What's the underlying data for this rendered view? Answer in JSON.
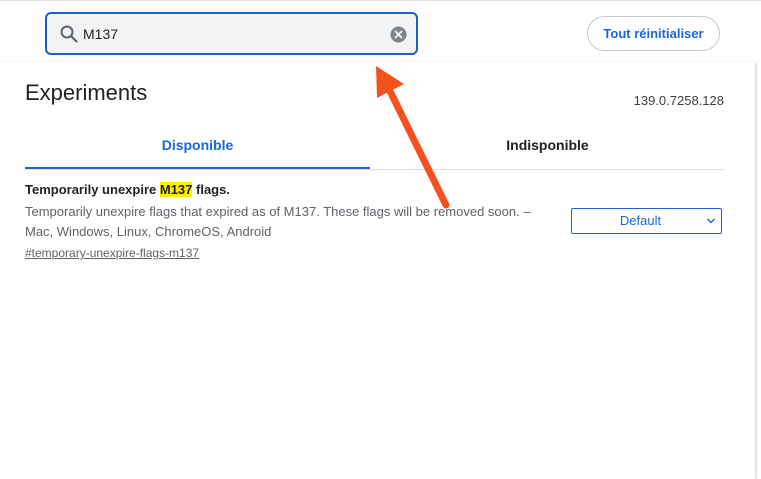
{
  "search": {
    "value": "M137",
    "icon": "search-icon",
    "clear_icon": "clear-icon"
  },
  "header": {
    "reset_label": "Tout réinitialiser"
  },
  "main": {
    "title": "Experiments",
    "version": "139.0.7258.128",
    "tabs": [
      {
        "label": "Disponible",
        "active": true
      },
      {
        "label": "Indisponible",
        "active": false
      }
    ]
  },
  "flag": {
    "name_prefix": "Temporarily unexpire ",
    "name_highlight": "M137",
    "name_suffix": " flags.",
    "description": "Temporarily unexpire flags that expired as of M137. These flags will be removed soon. – Mac, Windows, Linux, ChromeOS, Android",
    "link": "#temporary-unexpire-flags-m137",
    "select_value": "Default"
  },
  "colors": {
    "accent": "#1967d2",
    "highlight": "#ffee00",
    "annotation_arrow": "#f4511e"
  }
}
